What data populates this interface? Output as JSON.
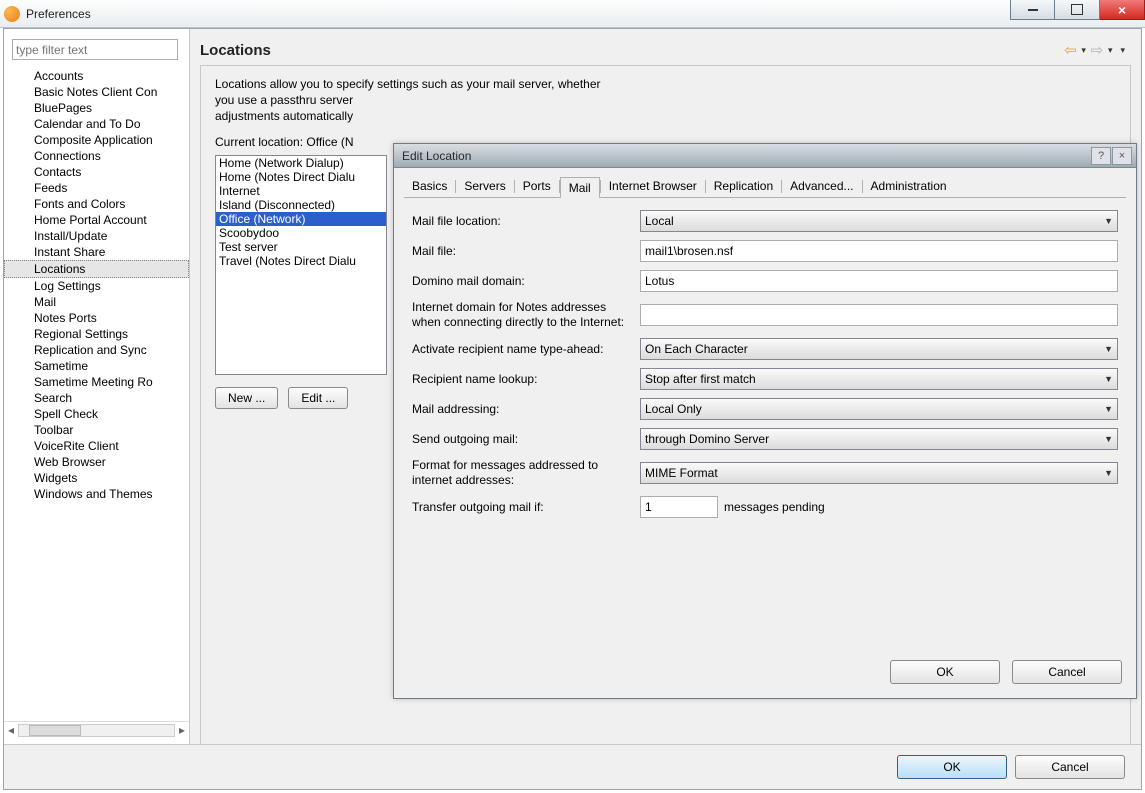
{
  "window": {
    "title": "Preferences"
  },
  "filter": {
    "placeholder": "type filter text"
  },
  "tree": [
    "Accounts",
    "Basic Notes Client Con",
    "BluePages",
    "Calendar and To Do",
    "Composite Application",
    "Connections",
    "Contacts",
    "Feeds",
    "Fonts and Colors",
    "Home Portal Account",
    "Install/Update",
    "Instant Share",
    "Locations",
    "Log Settings",
    "Mail",
    "Notes Ports",
    "Regional Settings",
    "Replication and Sync",
    "Sametime",
    "Sametime Meeting Ro",
    "Search",
    "Spell Check",
    "Toolbar",
    "VoiceRite Client",
    "Web Browser",
    "Widgets",
    "Windows and Themes"
  ],
  "tree_selected": "Locations",
  "main": {
    "title": "Locations",
    "description_line1": "Locations allow you to specify settings such as your mail server, whether",
    "description_line2": "you use a passthru server",
    "description_line3": "adjustments automatically",
    "current_label": "Current location: Office (N",
    "locations": [
      "Home (Network Dialup)",
      "Home (Notes Direct Dialu",
      "Internet",
      "Island (Disconnected)",
      "Office (Network)",
      "Scoobydoo",
      "Test server",
      "Travel (Notes Direct Dialu"
    ],
    "loc_selected": "Office (Network)",
    "buttons": {
      "new": "New ...",
      "edit": "Edit ..."
    },
    "ok": "OK",
    "cancel": "Cancel"
  },
  "dialog": {
    "title": "Edit Location",
    "tabs": [
      "Basics",
      "Servers",
      "Ports",
      "Mail",
      "Internet Browser",
      "Replication",
      "Advanced...",
      "Administration"
    ],
    "active_tab": "Mail",
    "fields": {
      "mail_file_location": {
        "label": "Mail file location:",
        "value": "Local"
      },
      "mail_file": {
        "label": "Mail file:",
        "value": "mail1\\brosen.nsf"
      },
      "domino_domain": {
        "label": "Domino mail domain:",
        "value": "Lotus"
      },
      "internet_domain": {
        "label": "Internet domain for Notes addresses when connecting directly to the Internet:",
        "value": ""
      },
      "typeahead": {
        "label": "Activate recipient name type-ahead:",
        "value": "On Each Character"
      },
      "lookup": {
        "label": "Recipient name lookup:",
        "value": "Stop after first match"
      },
      "mail_addressing": {
        "label": "Mail addressing:",
        "value": "Local Only"
      },
      "send_outgoing": {
        "label": "Send outgoing mail:",
        "value": "through Domino Server"
      },
      "format": {
        "label": "Format for messages addressed to internet addresses:",
        "value": "MIME Format"
      },
      "transfer": {
        "label": "Transfer outgoing mail if:",
        "value": "1",
        "suffix": "messages pending"
      }
    },
    "ok": "OK",
    "cancel": "Cancel"
  }
}
